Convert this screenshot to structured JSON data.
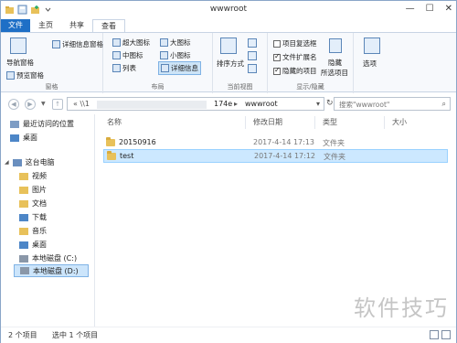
{
  "window": {
    "title": "wwwroot",
    "controls": [
      "—",
      "☐",
      "✕"
    ]
  },
  "tabs": [
    {
      "label": "文件"
    },
    {
      "label": "主页"
    },
    {
      "label": "共享"
    },
    {
      "label": "查看"
    }
  ],
  "ribbon": {
    "panes": {
      "nav_pane": "导航窗格",
      "preview_pane": "预览窗格",
      "details_pane": "详细信息窗格",
      "label": "窗格"
    },
    "layout": {
      "items": [
        "超大图标",
        "大图标",
        "中图标",
        "小图标",
        "列表",
        "详细信息"
      ],
      "label": "布局"
    },
    "current_view": {
      "sort": "排序方式",
      "label": "当前视图"
    },
    "show_hide": {
      "item_checkboxes": "项目复选框",
      "file_extensions": "文件扩展名",
      "hidden_items": "隐藏的项目",
      "hide_selected": "隐藏",
      "hide_selected_2": "所选项目",
      "label": "显示/隐藏"
    },
    "options": "选项"
  },
  "address": {
    "path_left": "« \\\\1",
    "path_mid": "174e",
    "path_arrow": "▸",
    "current": "wwwroot",
    "search_placeholder": "搜索\"wwwroot\""
  },
  "nav": {
    "quick_access": "最近访问的位置",
    "desktop_top": "桌面",
    "this_pc": "这台电脑",
    "items": [
      "视频",
      "图片",
      "文档",
      "下载",
      "音乐",
      "桌面"
    ],
    "drive_c": "本地磁盘 (C:)",
    "drive_d": "本地磁盘 (D:)"
  },
  "list": {
    "headers": {
      "name": "名称",
      "modified": "修改日期",
      "type": "类型",
      "size": "大小"
    },
    "rows": [
      {
        "name": "20150916",
        "modified": "2017-4-14 17:13",
        "type": "文件夹",
        "size": ""
      },
      {
        "name": "test",
        "modified": "2017-4-14 17:12",
        "type": "文件夹",
        "size": ""
      }
    ]
  },
  "status": {
    "count": "2 个项目",
    "selected": "选中 1 个项目"
  },
  "watermark": "软件技巧",
  "colors": {
    "file_tab": "#1e6fc6",
    "selection": "#cce8ff",
    "folder": "#e8c15a"
  }
}
